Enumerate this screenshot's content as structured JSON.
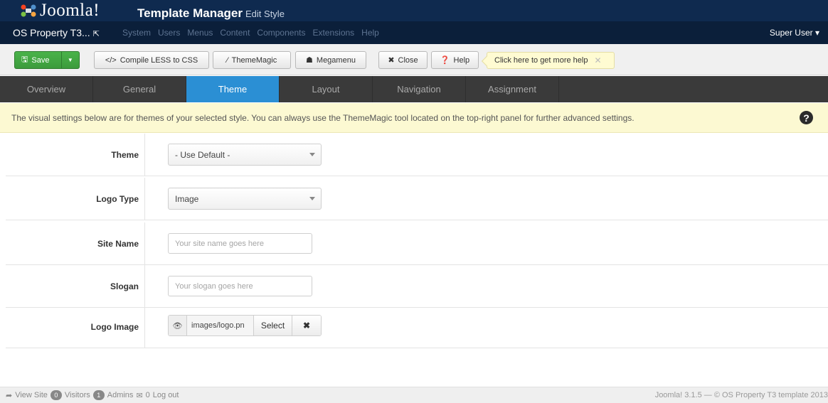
{
  "header": {
    "logo_text": "Joomla!",
    "page_title": "Template Manager",
    "page_subtitle": "Edit Style",
    "site_link": "OS Property T3...",
    "menu": [
      "System",
      "Users",
      "Menus",
      "Content",
      "Components",
      "Extensions",
      "Help"
    ],
    "user": "Super User"
  },
  "toolbar": {
    "save": "Save",
    "compile": "Compile LESS to CSS",
    "thememagic": "ThemeMagic",
    "megamenu": "Megamenu",
    "close": "Close",
    "help": "Help",
    "help_tip": "Click here to get more help"
  },
  "tabs": [
    "Overview",
    "General",
    "Theme",
    "Layout",
    "Navigation",
    "Assignment"
  ],
  "active_tab": "Theme",
  "notice": "The visual settings below are for themes of your selected style. You can always use the ThemeMagic tool located on the top-right panel for further advanced settings.",
  "form": {
    "theme": {
      "label": "Theme",
      "value": "- Use Default -"
    },
    "logo_type": {
      "label": "Logo Type",
      "value": "Image"
    },
    "site_name": {
      "label": "Site Name",
      "placeholder": "Your site name goes here"
    },
    "slogan": {
      "label": "Slogan",
      "placeholder": "Your slogan goes here"
    },
    "logo_image": {
      "label": "Logo Image",
      "value": "images/logo.pn",
      "select": "Select"
    }
  },
  "footer": {
    "view_site": "View Site",
    "visitors_count": "0",
    "visitors": "Visitors",
    "admins_count": "1",
    "admins": "Admins",
    "messages_count": "0",
    "logout": "Log out",
    "copyright": "Joomla! 3.1.5 — © OS Property T3 template 2013"
  },
  "colors": {
    "header": "#0f2a4f",
    "save_green": "#3c9b3c",
    "active_tab": "#2b8fd4",
    "notice_bg": "#fcf9d2"
  }
}
